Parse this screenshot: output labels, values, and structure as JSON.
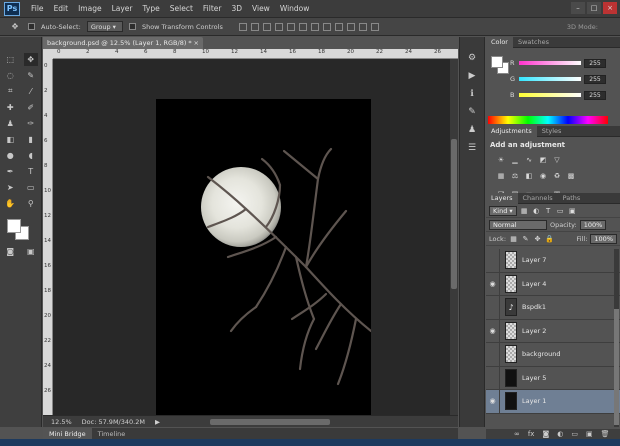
{
  "app": {
    "logo": "Ps"
  },
  "menu": [
    "File",
    "Edit",
    "Image",
    "Layer",
    "Type",
    "Select",
    "Filter",
    "3D",
    "View",
    "Window"
  ],
  "window_controls": [
    "–",
    "□",
    "×"
  ],
  "options_bar": {
    "auto_select_label": "Auto-Select:",
    "auto_select_value": "Group",
    "show_transform_label": "Show Transform Controls",
    "mode_3d_label": "3D Mode:"
  },
  "document": {
    "tab_title": "background.psd @ 12.5% (Layer 1, RGB/8) *",
    "tab_close": "×",
    "ruler_top": [
      "0",
      "2",
      "4",
      "6",
      "8",
      "10",
      "12",
      "14",
      "16",
      "18",
      "20",
      "22",
      "24",
      "26"
    ],
    "ruler_left": [
      "0",
      "2",
      "4",
      "6",
      "8",
      "10",
      "12",
      "14",
      "16",
      "18",
      "20",
      "22",
      "24",
      "26"
    ]
  },
  "status": {
    "zoom": "12.5%",
    "doc_size": "Doc: 57.9M/340.2M"
  },
  "bottom_tabs": [
    "Mini Bridge",
    "Timeline"
  ],
  "color_panel": {
    "tabs": [
      "Color",
      "Swatches"
    ],
    "sliders": [
      {
        "label": "R",
        "value": "255",
        "gradient": "#ff33cc"
      },
      {
        "label": "G",
        "value": "255",
        "gradient": "#33e6ff"
      },
      {
        "label": "B",
        "value": "255",
        "gradient": "#ffff33"
      }
    ]
  },
  "adjustments_panel": {
    "tabs": [
      "Adjustments",
      "Styles"
    ],
    "title": "Add an adjustment"
  },
  "layers_panel": {
    "tabs": [
      "Layers",
      "Channels",
      "Paths"
    ],
    "kind_label": "Kind",
    "blend_mode": "Normal",
    "opacity_label": "Opacity:",
    "opacity_value": "100%",
    "lock_label": "Lock:",
    "fill_label": "Fill:",
    "fill_value": "100%",
    "layers": [
      {
        "name": "Layer 7",
        "visible": false,
        "thumb": "checker"
      },
      {
        "name": "Layer 4",
        "visible": true,
        "thumb": "checker"
      },
      {
        "name": "Bspdk1",
        "visible": false,
        "thumb": "adjust"
      },
      {
        "name": "Layer 2",
        "visible": true,
        "thumb": "checker"
      },
      {
        "name": "background",
        "visible": false,
        "thumb": "checker"
      },
      {
        "name": "Layer 5",
        "visible": false,
        "thumb": "checker"
      },
      {
        "name": "Layer 1",
        "visible": true,
        "thumb": "dark",
        "selected": true
      }
    ]
  }
}
